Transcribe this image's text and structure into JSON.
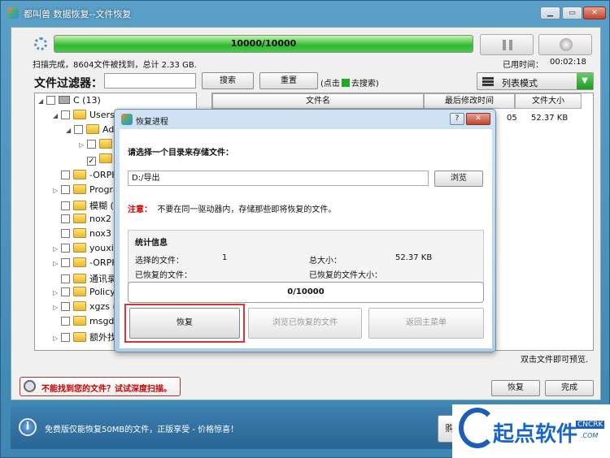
{
  "window": {
    "title": "都叫兽 数据恢复--文件恢复"
  },
  "scan": {
    "progress_text": "10000/10000",
    "progress_fraction": 1.0,
    "status": "扫描完成，8604文件被找到，总计 2.33 GB.",
    "elapsed_label": "已用时间：",
    "elapsed_value": "00:02:18"
  },
  "filter": {
    "label": "文件过滤器：",
    "input_value": "",
    "search_label": "搜索",
    "reset_label": "重置",
    "hint_prefix": "(点击",
    "hint_suffix": "去搜索)"
  },
  "view": {
    "mode_label": "列表模式"
  },
  "tree": {
    "root": "C (13)",
    "items": [
      "Users",
      "Adr",
      "",
      "",
      "-ORPH",
      "Progra",
      "模糊 (8",
      "nox2 (",
      "nox3 (",
      "youxin",
      "-ORPH",
      "通讯录",
      "Policy (",
      "xgzs (",
      "msgdir",
      "额外找"
    ]
  },
  "list": {
    "columns": [
      "文件名",
      "最后修改时间",
      "文件大小"
    ],
    "row": {
      "time_partial": "05",
      "size": "52.37 KB"
    }
  },
  "dblclick_hint": "双击文件即可预览.",
  "deep_scan": {
    "label": "不能找到您的文件？试试深度扫描。"
  },
  "buttons": {
    "recover": "恢复",
    "done": "完成"
  },
  "footer": {
    "message": "免费版仅能恢复50MB的文件，正版享受 - 价格惊喜！",
    "buy_label": "购"
  },
  "logo": {
    "text": "起点软件",
    "cn": "CNCRK",
    "com": ".COM"
  },
  "dialog": {
    "title": "恢复进程",
    "prompt": "请选择一个目录来存储文件：",
    "path_value": "D:/导出",
    "browse_label": "浏览",
    "note_label": "注意：",
    "note_text": "不要在同一驱动器内，存储那些即将恢复的文件。",
    "stats": {
      "header": "统计信息",
      "selected_label": "选择的文件：",
      "selected_value": "1",
      "total_label": "总大小：",
      "total_value": "52.37 KB",
      "recovered_label": "已恢复的文件：",
      "recovered_size_label": "已恢复的文件大小："
    },
    "progress_text": "0/10000",
    "recover_label": "恢复",
    "browse_recovered_label": "浏览已恢复的文件",
    "back_label": "返回主菜单"
  }
}
